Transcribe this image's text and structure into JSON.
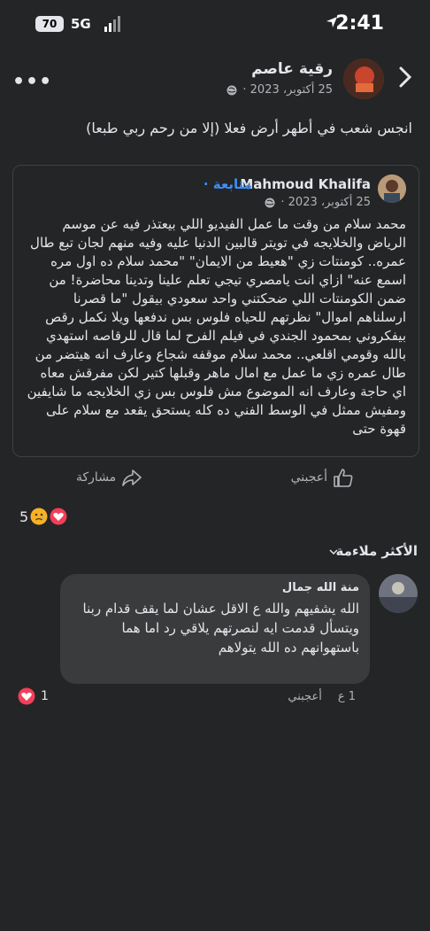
{
  "status_bar": {
    "time": "2:41",
    "battery": "70",
    "network": "5G"
  },
  "header": {
    "more_label": "•••"
  },
  "post": {
    "author": "رقية عاصم",
    "date": "25 أكتوبر، 2023 ·",
    "text": "انجس شعب في أطهر أرض فعلا (إلا من رحم ربي طبعا)"
  },
  "shared": {
    "author": "Mahmoud Khalifa",
    "follow_label": "· متابعة",
    "date": "25 أكتوبر، 2023 ·",
    "text": "محمد سلام من وقت ما عمل الفيديو اللي بيعتذر فيه عن موسم الرياض والخلايجه في تويتر قالبين الدنيا عليه وفيه منهم لجان تبع طال عمره.. كومنتات زي \"هعيط من الايمان\" \"محمد سلام ده اول مره اسمع عنه\" ازاي انت يامصري تيجي تعلم علينا وتدينا محاضرة! من ضمن الكومنتات اللي ضحكتني واحد سعودي بيقول \"ما قصرنا ارسلناهم اموال\" نظرتهم للحياه فلوس بس ندفعها ويلا نكمل رقص بيفكروني بمحمود الجندي في فيلم الفرح لما قال للرقاصه استهدي بالله وقومي اقلعي.. محمد سلام موقفه شجاع وعارف انه هيتضر من طال عمره زي ما عمل مع امال ماهر وقبلها كتير لكن مفرقش معاه اي حاجة وعارف انه الموضوع مش فلوس بس زي الخلايجه ما شايفين ومفيش ممثل في الوسط الفني ده كله يستحق يقعد مع سلام على قهوة حتى"
  },
  "actions": {
    "like_label": "أعجبني",
    "share_label": "مشاركة"
  },
  "reactions": {
    "count": "5"
  },
  "sort": {
    "label": "الأكثر ملاءمة"
  },
  "comment": {
    "author": "منة الله جمال",
    "text": "الله يشفيهم والله ع الاقل عشان لما يقف قدام ربنا ويتسأل قدمت ايه لنصرتهم يلاقي رد اما هما باستهوانهم ده الله يتولاهم",
    "time": "1 ع",
    "like_label": "أعجبني",
    "reaction_count": "1"
  },
  "colors": {
    "background": "#242526",
    "accent": "#3c8ff7",
    "bubble": "#3a3b3c"
  }
}
